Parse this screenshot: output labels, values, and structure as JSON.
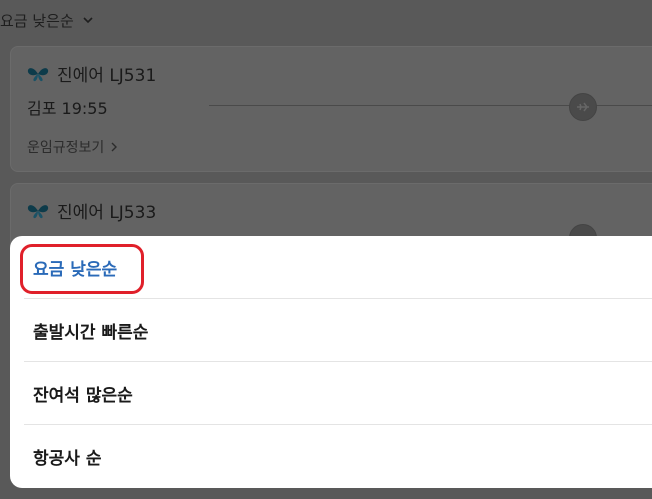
{
  "sort_header": {
    "label": "요금 낮은순"
  },
  "flights": [
    {
      "airline": "진에어 LJ531",
      "departure": "김포 19:55",
      "fare_rules": "운임규정보기"
    },
    {
      "airline": "진에어 LJ533",
      "departure": ""
    }
  ],
  "sort_options": [
    {
      "label": "요금 낮은순",
      "selected": true
    },
    {
      "label": "출발시간 빠른순",
      "selected": false
    },
    {
      "label": "잔여석 많은순",
      "selected": false
    },
    {
      "label": "항공사 순",
      "selected": false
    }
  ],
  "colors": {
    "selected": "#2a6ab8",
    "highlight": "#e0202a",
    "overlay": "#595959"
  }
}
